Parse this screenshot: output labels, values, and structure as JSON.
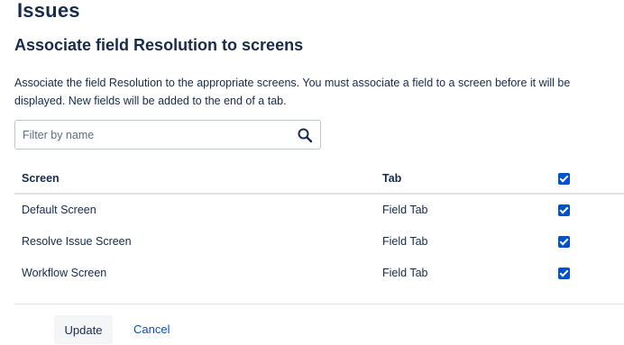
{
  "page": {
    "heading": "Issues",
    "section_title": "Associate field Resolution to screens",
    "description": "Associate the field Resolution to the appropriate screens. You must associate a field to a screen before it will be displayed. New fields will be added to the end of a tab."
  },
  "filter": {
    "placeholder": "Filter by name",
    "value": "",
    "icon": "search-icon"
  },
  "table": {
    "headers": {
      "screen": "Screen",
      "tab": "Tab",
      "select_all_checked": true
    },
    "rows": [
      {
        "screen": "Default Screen",
        "tab": "Field Tab",
        "checked": true
      },
      {
        "screen": "Resolve Issue Screen",
        "tab": "Field Tab",
        "checked": true
      },
      {
        "screen": "Workflow Screen",
        "tab": "Field Tab",
        "checked": true
      }
    ]
  },
  "actions": {
    "update_label": "Update",
    "cancel_label": "Cancel"
  },
  "colors": {
    "accent": "#0052cc",
    "text": "#172b4d",
    "border": "#dfe1e6"
  }
}
